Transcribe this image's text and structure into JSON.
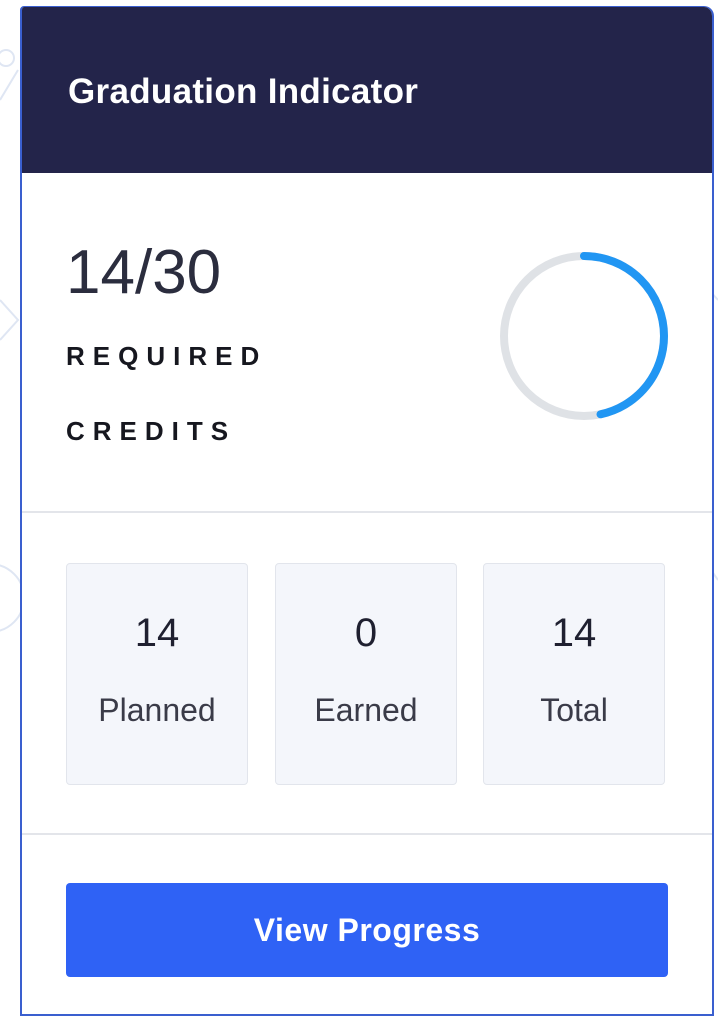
{
  "widget": {
    "title": "Graduation Indicator"
  },
  "credits": {
    "value_text": "14/30",
    "completed": 14,
    "required": 30,
    "caption_line1": "REQUIRED",
    "caption_line2": "CREDITS"
  },
  "stats": [
    {
      "value": "14",
      "label": "Planned"
    },
    {
      "value": "0",
      "label": "Earned"
    },
    {
      "value": "14",
      "label": "Total"
    }
  ],
  "actions": {
    "view_progress_label": "View Progress"
  },
  "colors": {
    "header_bg": "#23244a",
    "ring_progress": "#2196f3",
    "ring_track": "#dfe2e6",
    "button_bg": "#2f62f5",
    "stat_bg": "#f4f6fb"
  }
}
